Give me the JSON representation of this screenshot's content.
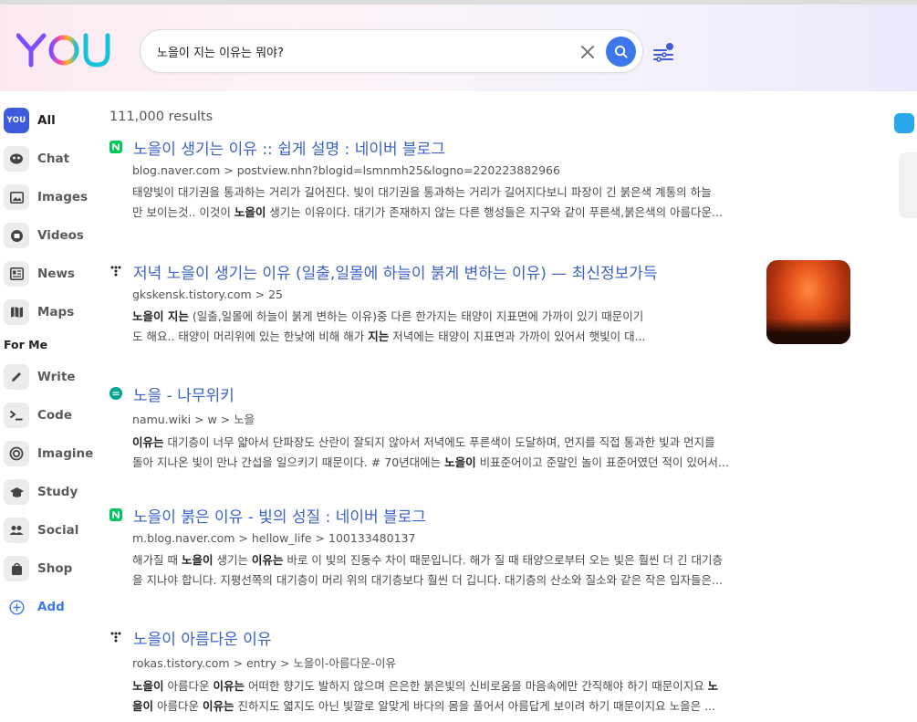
{
  "brand": {
    "logo_text": "YOU"
  },
  "search": {
    "query": "노을이 지는 이유는 뭐야?",
    "clear_icon": "close-icon",
    "submit_icon": "search-icon",
    "filter_icon": "filter-sliders-icon"
  },
  "sidebar": {
    "items": [
      {
        "id": "all",
        "label": "All",
        "icon": "you-icon",
        "active": true
      },
      {
        "id": "chat",
        "label": "Chat",
        "icon": "chat-icon"
      },
      {
        "id": "images",
        "label": "Images",
        "icon": "image-icon"
      },
      {
        "id": "videos",
        "label": "Videos",
        "icon": "video-icon"
      },
      {
        "id": "news",
        "label": "News",
        "icon": "news-icon"
      },
      {
        "id": "maps",
        "label": "Maps",
        "icon": "map-icon"
      }
    ],
    "section_label": "For Me",
    "apps": [
      {
        "id": "write",
        "label": "Write",
        "icon": "pencil-icon"
      },
      {
        "id": "code",
        "label": "Code",
        "icon": "terminal-icon"
      },
      {
        "id": "imagine",
        "label": "Imagine",
        "icon": "spiral-icon"
      },
      {
        "id": "study",
        "label": "Study",
        "icon": "graduation-cap-icon"
      },
      {
        "id": "social",
        "label": "Social",
        "icon": "people-icon"
      },
      {
        "id": "shop",
        "label": "Shop",
        "icon": "shopping-bag-icon"
      }
    ],
    "add_label": "Add"
  },
  "results_count": "111,000 results",
  "results": [
    {
      "title": "노을이 생기는 이유 :: 쉽게 설명 : 네이버 블로그",
      "url": "blog.naver.com > postview.nhn?blogid=lsmnmh25&logno=220223882966",
      "favicon": "naver-icon",
      "line1": "태양빛이 대기권을 통과하는 거리가 길어진다. 빛이 대기권을 통과하는 거리가 길어지다보니 파장이 긴 붉은색 계통의 하늘",
      "line2_a": "만 보이는것.. 이것이 ",
      "line2_b": "노을이",
      "line2_c": " 생기는 이유이다. 대기가 존재하지 않는 다른 행성들은 지구와 같이 푸른색,붉은색의 아름다운..."
    },
    {
      "title": "저녁 노을이 생기는 이유 (일출,일몰에 하늘이 붉게 변하는 이유) — 최신정보가득",
      "url": "gkskensk.tistory.com > 25",
      "favicon": "tistory-icon",
      "line1_a": "노을이 지는",
      "line1_b": " (일출,일몰에 하늘이 붉게 변하는 이유)중 다른 한가지는 태양이 지표면에 가까이 있기 때문이기",
      "line2_a": "도 해요.. 태양이 머리위에 있는 한낮에 비해 해가 ",
      "line2_b": "지는",
      "line2_c": " 저녁에는 태양이 지표면과 가까이 있어서 햇빛이 대..."
    },
    {
      "title": "노을 - 나무위키",
      "url": "namu.wiki > w > 노을",
      "favicon": "namuwiki-icon",
      "line1_a": "이유는",
      "line1_b": " 대기층이 너무 얇아서 단파장도 산란이 잘되지 않아서 저녁에도 푸른색이 도달하며, 먼지를 직접 통과한 빛과 먼지를",
      "line2_a": "돌아 지나온 빛이 만나 간섭을 일으키기 때문이다. # 70년대에는 ",
      "line2_b": "노을이",
      "line2_c": " 비표준어이고 준말인 놀이 표준어였던 적이 있어서..."
    },
    {
      "title": "노을이 붉은 이유 - 빛의 성질 : 네이버 블로그",
      "url": "m.blog.naver.com > hellow_life > 100133480137",
      "favicon": "naver-icon",
      "line1_a": "해가질 때 ",
      "line1_b": "노을이",
      "line1_c": " 생기는 ",
      "line1_d": "이유는",
      "line1_e": " 바로 이 빛의 진동수 차이 때문입니다. 해가 질 때 태양으로부터 오는 빛은 훨씬 더 긴 대기층",
      "line2": "을 지나야 합니다. 지평선쪽의 대기층이 머리 위의 대기층보다 훨씬 더 깁니다. 대기층의 산소와 질소와 같은 작은 입자들은..."
    },
    {
      "title": "노을이 아름다운 이유",
      "url": "rokas.tistory.com > entry > 노을이-아름다운-이유",
      "favicon": "tistory-icon",
      "line1_a": "노을이",
      "line1_b": " 아름다운 ",
      "line1_c": "이유는",
      "line1_d": " 어떠한 향기도 발하지 않으며 은은한 붉은빛의 신비로움을 마음속에만 간직해야 하기 때문이지요 ",
      "line1_e": "노",
      "line2_a": "을이",
      "line2_b": " 아름다운 ",
      "line2_c": "이유는",
      "line2_d": " 진하지도 엷지도 아닌 빛깔로 알맞게 바다의 몸을 풀어서 아름답게 보이려 하기 때문이지요 노을은 ..."
    }
  ],
  "colors": {
    "accent": "#3e78e8",
    "link": "#3a62c8",
    "naver": "#03c75a",
    "namu": "#00a495"
  }
}
